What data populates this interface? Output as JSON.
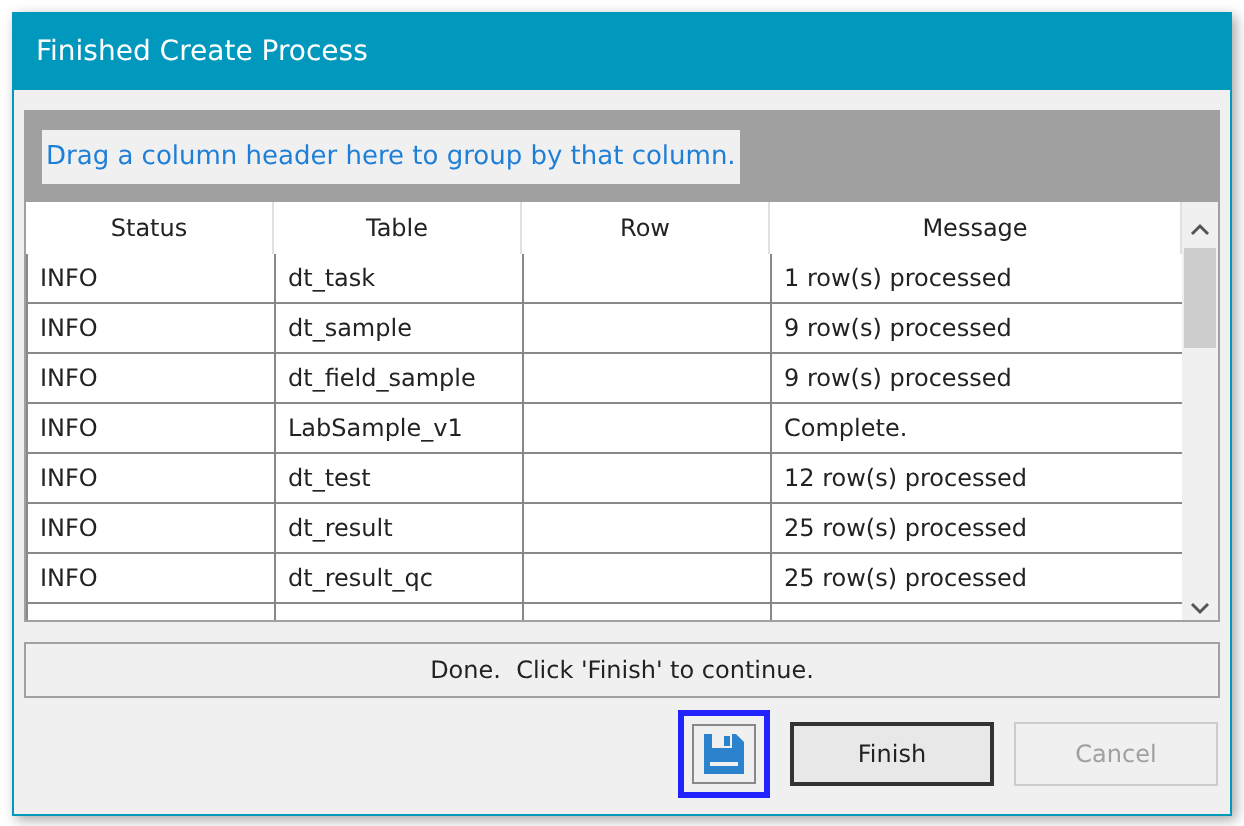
{
  "window": {
    "title": "Finished Create Process"
  },
  "group_panel": {
    "hint": "Drag a column header here to group by that column."
  },
  "table": {
    "columns": [
      "Status",
      "Table",
      "Row",
      "Message"
    ],
    "rows": [
      {
        "status": "INFO",
        "table": "dt_task",
        "row": "",
        "message": "1 row(s) processed"
      },
      {
        "status": "INFO",
        "table": "dt_sample",
        "row": "",
        "message": "9 row(s) processed"
      },
      {
        "status": "INFO",
        "table": "dt_field_sample",
        "row": "",
        "message": "9 row(s) processed"
      },
      {
        "status": "INFO",
        "table": "LabSample_v1",
        "row": "",
        "message": "Complete."
      },
      {
        "status": "INFO",
        "table": "dt_test",
        "row": "",
        "message": "12 row(s) processed"
      },
      {
        "status": "INFO",
        "table": "dt_result",
        "row": "",
        "message": "25 row(s) processed"
      },
      {
        "status": "INFO",
        "table": "dt_result_qc",
        "row": "",
        "message": "25 row(s) processed"
      }
    ]
  },
  "status_bar": "Done.  Click 'Finish' to continue.",
  "buttons": [
    {
      "kind": "icon",
      "highlighted": true,
      "disabled": false
    },
    {
      "kind": "text",
      "label": "Finish",
      "disabled": false
    },
    {
      "kind": "text",
      "label": "Cancel",
      "disabled": true
    }
  ]
}
